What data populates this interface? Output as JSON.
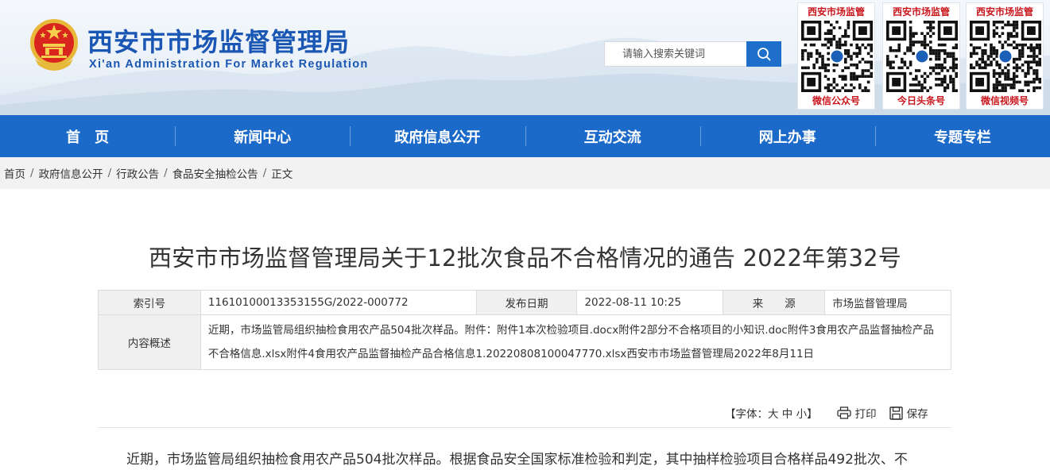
{
  "header": {
    "site_title": "西安市市场监督管理局",
    "site_subtitle": "Xi'an Administration For Market Regulation",
    "search": {
      "placeholder": "请输入搜索关键词"
    },
    "qr_cards": [
      {
        "top": "西安市场监管",
        "bottom": "微信公众号"
      },
      {
        "top": "西安市场监管",
        "bottom": "今日头条号"
      },
      {
        "top": "西安市场监管",
        "bottom": "微信视频号"
      }
    ],
    "colors": {
      "brand_blue": "#1a56b3",
      "nav_blue": "#1b6ac9",
      "qr_red": "#c8161d"
    }
  },
  "nav": {
    "items": [
      {
        "label": "首　页"
      },
      {
        "label": "新闻中心"
      },
      {
        "label": "政府信息公开"
      },
      {
        "label": "互动交流"
      },
      {
        "label": "网上办事"
      },
      {
        "label": "专题专栏"
      }
    ]
  },
  "breadcrumb": {
    "items": [
      "首页",
      "政府信息公开",
      "行政公告",
      "食品安全抽检公告",
      "正文"
    ]
  },
  "article": {
    "title": "西安市市场监督管理局关于12批次食品不合格情况的通告 2022年第32号",
    "meta": {
      "index_label": "索引号",
      "index_value": "11610100013353155G/2022-000772",
      "date_label": "发布日期",
      "date_value": "2022-08-11 10:25",
      "source_label": "来　　源",
      "source_value": "市场监督管理局",
      "summary_label": "内容概述",
      "summary_value": "近期，市场监管局组织抽检食用农产品504批次样品。附件：附件1本次检验项目.docx附件2部分不合格项目的小知识.doc附件3食用农产品监督抽检产品不合格信息.xlsx附件4食用农产品监督抽检产品合格信息1.20220808100047770.xlsx西安市市场监督管理局2022年8月11日"
    },
    "tools": {
      "font_prefix": "【字体：",
      "font_large": "大",
      "font_medium": "中",
      "font_small": "小",
      "font_suffix": "】",
      "print_label": "打印",
      "save_label": "保存"
    },
    "body_first_line": "近期，市场监管局组织抽检食用农产品504批次样品。根据食品安全国家标准检验和判定，其中抽样检验项目合格样品492批次、不"
  }
}
